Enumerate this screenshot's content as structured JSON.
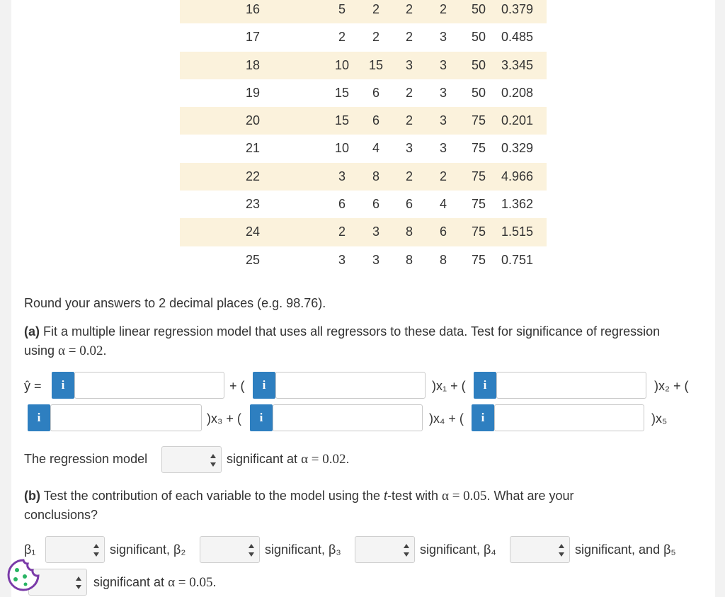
{
  "table": {
    "rows": [
      {
        "obs": "16",
        "x1": "5",
        "x2": "2",
        "x3": "2",
        "x4": "2",
        "x5": "50",
        "y": "0.379"
      },
      {
        "obs": "17",
        "x1": "2",
        "x2": "2",
        "x3": "2",
        "x4": "3",
        "x5": "50",
        "y": "0.485"
      },
      {
        "obs": "18",
        "x1": "10",
        "x2": "15",
        "x3": "3",
        "x4": "3",
        "x5": "50",
        "y": "3.345"
      },
      {
        "obs": "19",
        "x1": "15",
        "x2": "6",
        "x3": "2",
        "x4": "3",
        "x5": "50",
        "y": "0.208"
      },
      {
        "obs": "20",
        "x1": "15",
        "x2": "6",
        "x3": "2",
        "x4": "3",
        "x5": "75",
        "y": "0.201"
      },
      {
        "obs": "21",
        "x1": "10",
        "x2": "4",
        "x3": "3",
        "x4": "3",
        "x5": "75",
        "y": "0.329"
      },
      {
        "obs": "22",
        "x1": "3",
        "x2": "8",
        "x3": "2",
        "x4": "2",
        "x5": "75",
        "y": "4.966"
      },
      {
        "obs": "23",
        "x1": "6",
        "x2": "6",
        "x3": "6",
        "x4": "4",
        "x5": "75",
        "y": "1.362"
      },
      {
        "obs": "24",
        "x1": "2",
        "x2": "3",
        "x3": "8",
        "x4": "6",
        "x5": "75",
        "y": "1.515"
      },
      {
        "obs": "25",
        "x1": "3",
        "x2": "3",
        "x3": "8",
        "x4": "8",
        "x5": "75",
        "y": "0.751"
      }
    ]
  },
  "instructions": "Round your answers to 2 decimal places (e.g. 98.76).",
  "part_a": {
    "label": "(a)",
    "text_line1": " Fit a multiple linear regression model that uses all regressors to these data. Test for significance of regression",
    "text_line2_prefix": "using ",
    "alpha_expr": "α = 0.02",
    "text_line2_suffix": "."
  },
  "equation": {
    "yhat": "ŷ =",
    "plus_open": "+ (",
    "x1_term": ")x₁ + (",
    "x2_term": ")x₂ + (",
    "x3_term": ")x₃ + (",
    "x4_term": ")x₄ + (",
    "x5_term": ")x₅",
    "info_glyph": "i",
    "inputs": [
      "",
      "",
      "",
      "",
      "",
      ""
    ]
  },
  "regression_model": {
    "label": "The regression model",
    "select_value": "",
    "suffix": "significant at ",
    "alpha_expr": "α = 0.02",
    "end": "."
  },
  "part_b": {
    "label": "(b)",
    "text_line1_prefix": " Test the contribution of each variable to the model using the ",
    "t_italic": "t",
    "text_line1_mid": "-test with ",
    "alpha_expr": "α = 0.05",
    "text_line1_suffix": ". What are your",
    "text_line2": "conclusions?"
  },
  "conclusions": {
    "b1_label": "β₁",
    "b2_label": "significant, β₂",
    "b3_label": "significant, β₃",
    "b4_label": "significant, β₄",
    "b5_label": "significant, and β₅",
    "final_prefix": "significant at ",
    "final_alpha": "α = 0.05",
    "final_end": ".",
    "select_values": [
      "",
      "",
      "",
      "",
      ""
    ]
  },
  "colors": {
    "info_button": "#2e7fc0",
    "row_shade": "#fbf2dc"
  },
  "icons": [
    "info-icon",
    "select-arrows-icon",
    "cookie-icon"
  ]
}
